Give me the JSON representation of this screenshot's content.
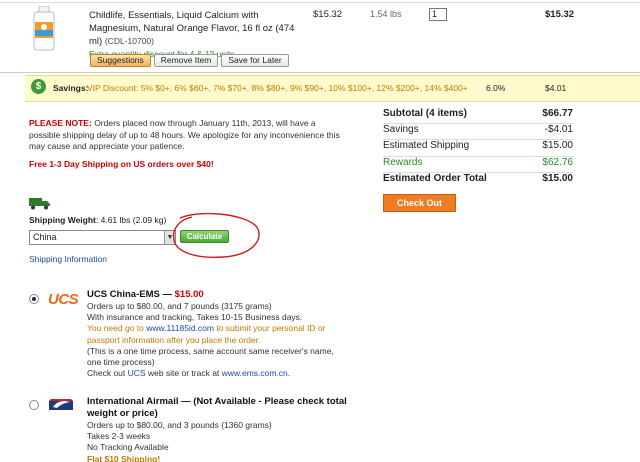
{
  "product": {
    "name": "Childlife, Essentials, Liquid Calcium with Magnesium, Natural Orange Flavor, 16 fl oz (474 ml)",
    "code": "(CDL-10700)",
    "discount_note": "Extra quantity discount for 4 & 12 units",
    "price": "$15.32",
    "weight": "1.54 lbs",
    "qty": "1",
    "total": "$15.32",
    "buttons": [
      "Suggestions",
      "Remove Item",
      "Save for Later"
    ]
  },
  "savings": {
    "label": "Savings:",
    "text": "VIP Discount: 5% $0+, 6% $60+, 7% $70+, 8% $80+, 9% $90+, 10% $100+, 12% $200+, 14% $400+",
    "percent": "6.0%",
    "amount": "$4.01"
  },
  "notice": {
    "label": "PLEASE NOTE:",
    "text": "Orders placed now through January 11th, 2013, will have a possible shipping delay of up to 48 hours. We apologize for any inconvenience this may cause and appreciate your patience.",
    "free_shipping": "Free 1-3 Day Shipping on US orders over $40!"
  },
  "totals": {
    "rows": [
      {
        "label": "Subtotal (4 items)",
        "value": "$66.77"
      },
      {
        "label": "Savings",
        "value": "-$4.01"
      },
      {
        "label": "Estimated Shipping",
        "value": "$15.00"
      },
      {
        "label": "Rewards",
        "value": "$62.76"
      },
      {
        "label": "Estimated Order Total",
        "value": "$15.00"
      }
    ],
    "checkout_label": "Check Out"
  },
  "shipping": {
    "weight_label": "Shipping Weight",
    "weight_value": ": 4.61 lbs (2.09 kg)",
    "country": "China",
    "calculate_label": "Calculate",
    "info_link": "Shipping Information"
  },
  "option_ucs": {
    "logo": "UCS",
    "title": "UCS China-EMS — ",
    "price": "$15.00",
    "line1": "Orders up to $80.00, and 7 pounds (3175 grams)",
    "line2": "With insurance and tracking, Takes 10-15 Business days.",
    "line3a": "You need go to ",
    "line3_link": "www.11185id.com",
    "line3b": " to submit your personal ID or passport information after you place the order.",
    "line4": "(This is a one time process, same account same receiver's name, one time process)",
    "line5a": "Check out ",
    "line5_ucs": "UCS",
    "line5b": " web site or track at ",
    "line5_link": "www.ems.com.cn",
    "line5c": "."
  },
  "option_intl": {
    "title": "International Airmail — (Not Available - Please check total weight or price)",
    "line1": "Orders up to $80.00, and 3 pounds (1360 grams)",
    "line2": "Takes 2-3 weeks",
    "line3": "No Tracking Available",
    "line4": "Flat $10 Shipping!"
  },
  "colors": {
    "accent_orange": "#f07c23",
    "savings_green": "#3d9a32",
    "notice_red": "#cc0000",
    "link_blue": "#1a4aa8"
  }
}
